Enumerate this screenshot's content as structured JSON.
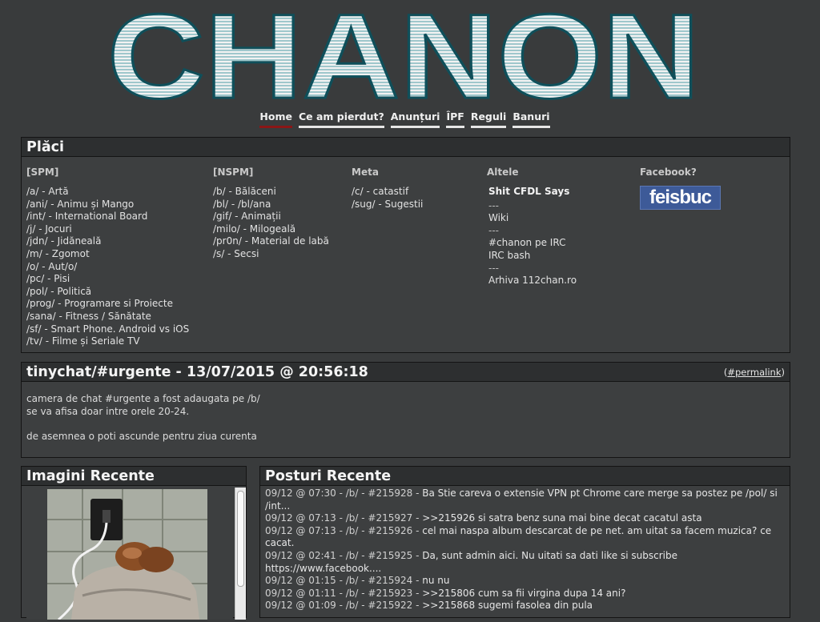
{
  "site": {
    "logo_text": "CHANON"
  },
  "nav": [
    {
      "label": "Home",
      "active": true
    },
    {
      "label": "Ce am pierdut?",
      "active": false
    },
    {
      "label": "Anunțuri",
      "active": false
    },
    {
      "label": "ÎPF",
      "active": false
    },
    {
      "label": "Reguli",
      "active": false
    },
    {
      "label": "Banuri",
      "active": false
    }
  ],
  "boards": {
    "title": "Plăci",
    "spm": {
      "heading": "[SPM]",
      "items": [
        "/a/ - Artă",
        "/ani/ - Animu și Mango",
        "/int/ - International Board",
        "/j/ - Jocuri",
        "/jdn/ - Jidăneală",
        "/m/ - Zgomot",
        "/o/ - Aut/o/",
        "/pc/ - Pisi",
        "/pol/ - Politică",
        "/prog/ - Programare si Proiecte",
        "/sana/ - Fitness / Sănătate",
        "/sf/ - Smart Phone. Android vs iOS",
        "/tv/ - Filme și Seriale TV"
      ]
    },
    "nspm": {
      "heading": "[NSPM]",
      "items": [
        "/b/ - Bălăceni",
        "/bl/ - /bl/ana",
        "/gif/ - Animații",
        "/milo/ - Milogeală",
        "/pr0n/ - Material de labă",
        "/s/ - Secsi"
      ]
    },
    "meta": {
      "heading": "Meta",
      "items": [
        "/c/ - catastif",
        "/sug/ - Sugestii"
      ]
    },
    "altele": {
      "heading": "Altele",
      "items": [
        "Shit CFDL Says",
        "---",
        "Wiki",
        "---",
        "#chanon pe IRC",
        "IRC bash",
        "---",
        "Arhiva 112chan.ro"
      ]
    },
    "facebook": {
      "heading": "Facebook?",
      "button": "feisbuc"
    }
  },
  "news": {
    "title": "tinychat/#urgente - 13/07/2015 @ 20:56:18",
    "permalink_open": "(",
    "permalink_text": "#permalink",
    "permalink_close": ")",
    "lines": [
      "camera de chat #urgente a fost adaugata pe /b/",
      "se va afisa doar intre orele 20-24.",
      "",
      "de asemnea o poti ascunde pentru ziua curenta"
    ]
  },
  "recent_images": {
    "title": "Imagini Recente"
  },
  "recent_posts": {
    "title": "Posturi Recente",
    "items": [
      {
        "meta": "09/12 @ 07:30 - /b/ - #215928 - ",
        "text": "Ba Stie careva o extensie VPN pt Chrome care merge sa postez pe /pol/ si /int..."
      },
      {
        "meta": "09/12 @ 07:13 - /b/ - #215927 - ",
        "text": ">>215926 si satra benz suna mai bine decat cacatul asta"
      },
      {
        "meta": "09/12 @ 07:13 - /b/ - #215926 - ",
        "text": "cel mai naspa album descarcat de pe net. am uitat sa facem muzica? ce cacat."
      },
      {
        "meta": "09/12 @ 02:41 - /b/ - #215925 - ",
        "text": "Da, sunt admin aici. Nu uitati sa dati like si subscribe https://www.facebook...."
      },
      {
        "meta": "09/12 @ 01:15 - /b/ - #215924 - ",
        "text": "nu nu"
      },
      {
        "meta": "09/12 @ 01:11 - /b/ - #215923 - ",
        "text": ">>215806 cum sa fii virgina dupa 14 ani?"
      },
      {
        "meta": "09/12 @ 01:09 - /b/ - #215922 - ",
        "text": ">>215868 sugemi fasolea din pula"
      }
    ]
  },
  "colors": {
    "background": "#393b3c",
    "box_title": "#2d2f30",
    "nav_active": "#8b1616",
    "facebook": "#3d5a98"
  }
}
